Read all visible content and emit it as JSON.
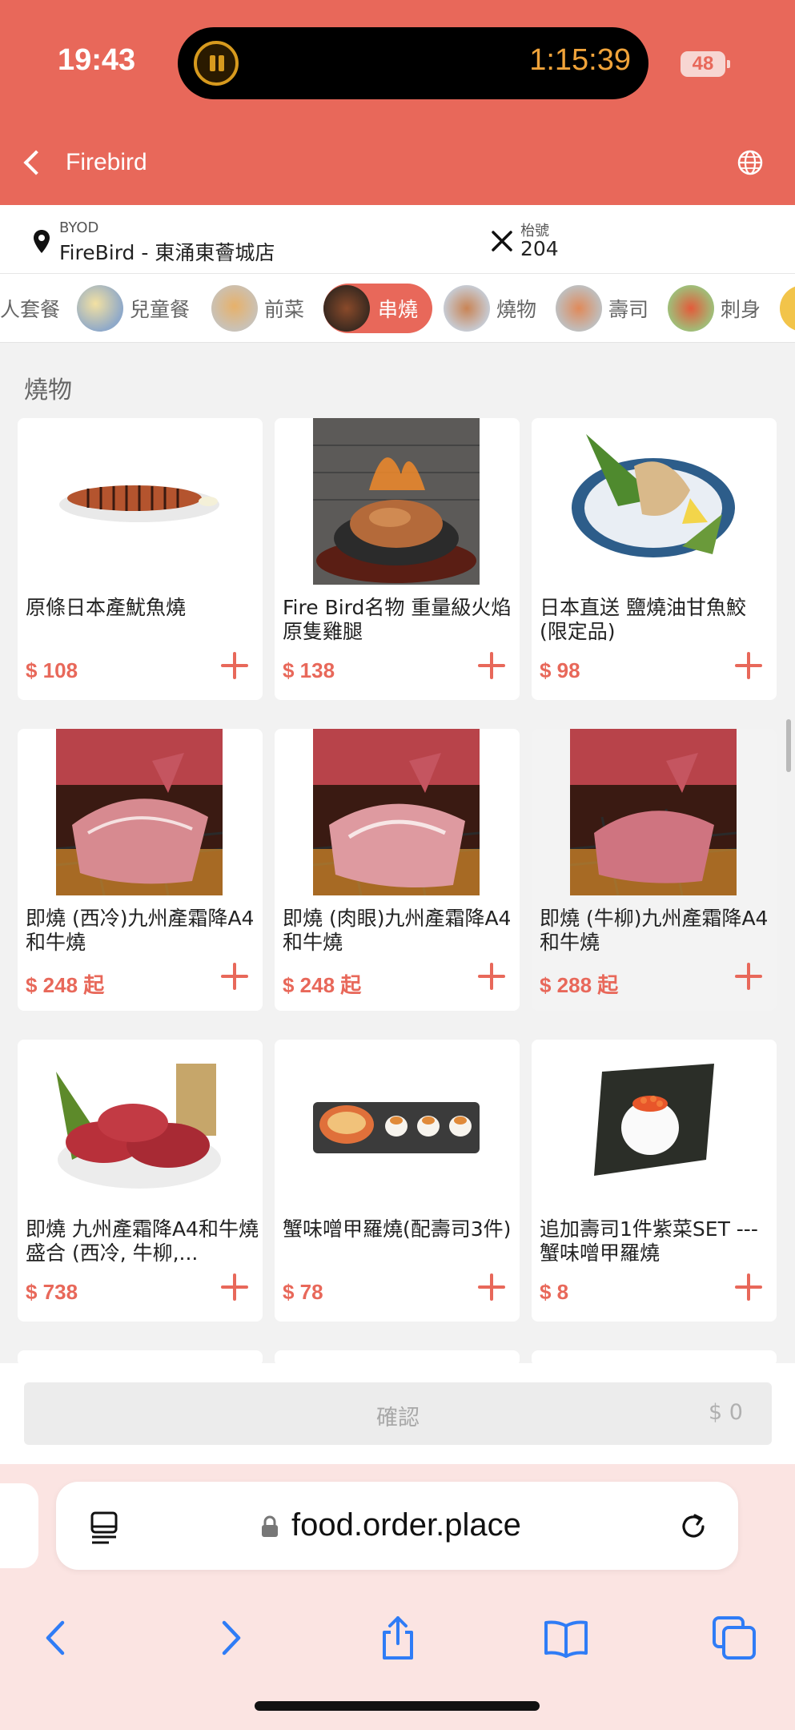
{
  "status": {
    "time": "19:43",
    "timer": "1:15:39",
    "battery": "48"
  },
  "header": {
    "title": "Firebird"
  },
  "info": {
    "mode_label": "BYOD",
    "store": "FireBird - 東涌東薈城店",
    "table_label": "枱號",
    "table_number": "204"
  },
  "categories": [
    {
      "label": "人套餐",
      "active": false
    },
    {
      "label": "兒童餐",
      "active": false
    },
    {
      "label": "前菜",
      "active": false
    },
    {
      "label": "串燒",
      "active": true
    },
    {
      "label": "燒物",
      "active": false
    },
    {
      "label": "壽司",
      "active": false
    },
    {
      "label": "刺身",
      "active": false
    }
  ],
  "section": {
    "title": "燒物"
  },
  "items": [
    {
      "name": "原條日本產魷魚燒",
      "price": "$ 108"
    },
    {
      "name": "Fire Bird名物 重量級火焰原隻雞腿",
      "price": "$ 138"
    },
    {
      "name": "日本直送 鹽燒油甘魚鮫(限定品)",
      "price": "$ 98"
    },
    {
      "name": "即燒 (西冷)九州產霜降A4和牛燒",
      "price": "$ 248 起"
    },
    {
      "name": "即燒 (肉眼)九州產霜降A4和牛燒",
      "price": "$ 248 起"
    },
    {
      "name": "即燒 (牛柳)九州產霜降A4和牛燒",
      "price": "$ 288 起"
    },
    {
      "name": "即燒 九州產霜降A4和牛燒盛合 (西冷, 牛柳,...",
      "price": "$ 738"
    },
    {
      "name": "蟹味噌甲羅燒(配壽司3件)",
      "price": "$ 78"
    },
    {
      "name": "追加壽司1件紫菜SET --- 蟹味噌甲羅燒",
      "price": "$ 8"
    }
  ],
  "confirm": {
    "label": "確認",
    "total": "$ 0"
  },
  "browser": {
    "url": "food.order.place"
  },
  "colors": {
    "brand": "#e8685a",
    "background": "#f2f2f2"
  }
}
